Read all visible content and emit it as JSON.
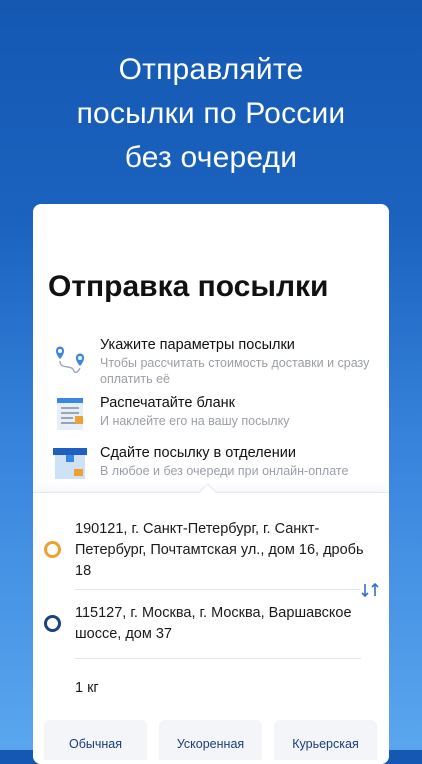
{
  "hero": {
    "lines": [
      "Отправляйте",
      "посылки по России",
      "без очереди"
    ]
  },
  "card": {
    "title": "Отправка посылки",
    "steps": [
      {
        "title": "Укажите параметры посылки",
        "subtitle": "Чтобы рассчитать стоимость доставки и сразу оплатить её",
        "icon": "map-route-icon"
      },
      {
        "title": "Распечатайте бланк",
        "subtitle": "И наклейте его на вашу посылку",
        "icon": "printed-form-icon"
      },
      {
        "title": "Сдайте посылку в отделении",
        "subtitle": "В любое и без очереди при онлайн-оплате",
        "icon": "parcel-box-icon"
      }
    ]
  },
  "form": {
    "from_address": "190121, г. Санкт-Петербург, г. Санкт-Петербург, Почтамтская ул., дом 16, дробь 18",
    "to_address": "115127, г. Москва, г. Москва, Варшавское шоссе, дом 37",
    "weight": "1 кг",
    "from_color": "#f0a030",
    "to_color": "#1d3f8a"
  },
  "tabs": [
    "Обычная",
    "Ускоренная",
    "Курьерская"
  ],
  "colors": {
    "brand_blue": "#1458b2",
    "accent_navy": "#1a3d7c",
    "muted_text": "#9a9ea6"
  }
}
